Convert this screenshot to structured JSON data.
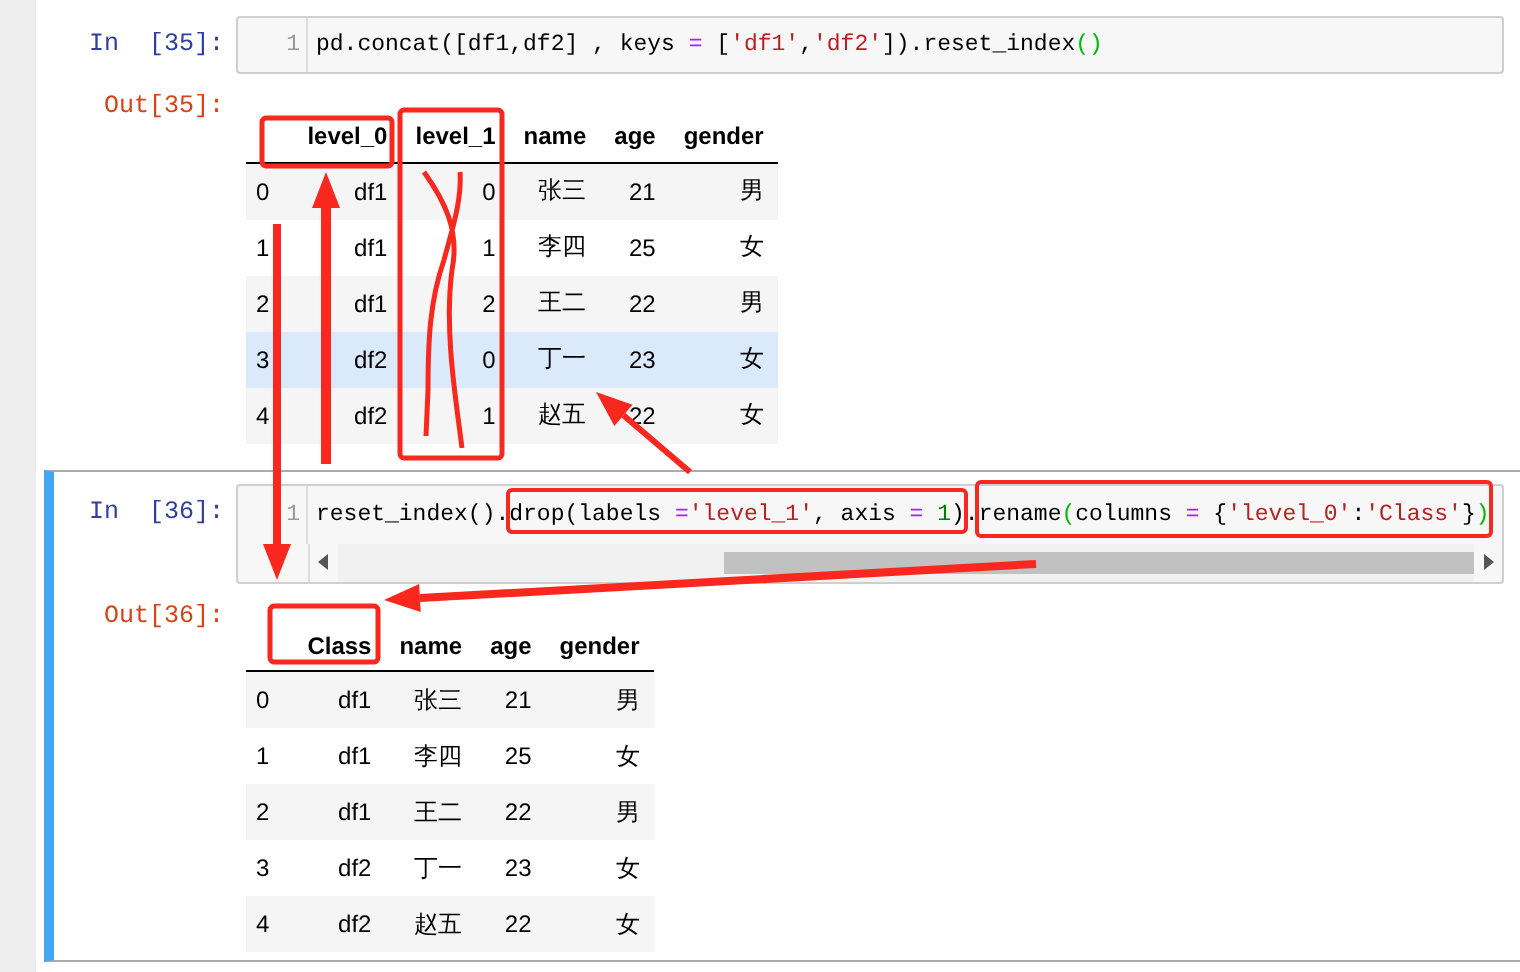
{
  "cells": [
    {
      "prompt_in": "In  [35]:",
      "selected": false,
      "h_scrollbar": false,
      "line_number": "1",
      "code": [
        {
          "text": "pd.concat([df1,df2] , keys ",
          "kind": "plain"
        },
        {
          "text": "=",
          "kind": "op"
        },
        {
          "text": " [",
          "kind": "plain"
        },
        {
          "text": "'df1'",
          "kind": "string"
        },
        {
          "text": ",",
          "kind": "plain"
        },
        {
          "text": "'df2'",
          "kind": "string"
        },
        {
          "text": "]).reset_index",
          "kind": "plain"
        },
        {
          "text": "()",
          "kind": "paren"
        }
      ],
      "prompt_out": "Out[35]:",
      "table": {
        "columns": [
          "level_0",
          "level_1",
          "name",
          "age",
          "gender"
        ],
        "rows": [
          {
            "index": "0",
            "cells": [
              "df1",
              "0",
              "张三",
              "21",
              "男"
            ],
            "hovered": false
          },
          {
            "index": "1",
            "cells": [
              "df1",
              "1",
              "李四",
              "25",
              "女"
            ],
            "hovered": false
          },
          {
            "index": "2",
            "cells": [
              "df1",
              "2",
              "王二",
              "22",
              "男"
            ],
            "hovered": false
          },
          {
            "index": "3",
            "cells": [
              "df2",
              "0",
              "丁一",
              "23",
              "女"
            ],
            "hovered": true
          },
          {
            "index": "4",
            "cells": [
              "df2",
              "1",
              "赵五",
              "22",
              "女"
            ],
            "hovered": false
          }
        ]
      }
    },
    {
      "prompt_in": "In  [36]:",
      "selected": true,
      "h_scrollbar": true,
      "line_number": "1",
      "code": [
        {
          "text": "reset_index().",
          "kind": "plain"
        },
        {
          "text": "drop(labels ",
          "kind": "plain"
        },
        {
          "text": "=",
          "kind": "op"
        },
        {
          "text": "'level_1'",
          "kind": "string"
        },
        {
          "text": ", axis ",
          "kind": "plain"
        },
        {
          "text": "=",
          "kind": "op"
        },
        {
          "text": " 1",
          "kind": "number"
        },
        {
          "text": ")",
          "kind": "plain"
        },
        {
          "text": ".",
          "kind": "plain"
        },
        {
          "text": "rename",
          "kind": "plain"
        },
        {
          "text": "(",
          "kind": "paren"
        },
        {
          "text": "columns ",
          "kind": "plain"
        },
        {
          "text": "=",
          "kind": "op"
        },
        {
          "text": " {",
          "kind": "plain"
        },
        {
          "text": "'level_0'",
          "kind": "string"
        },
        {
          "text": ":",
          "kind": "plain"
        },
        {
          "text": "'Class'",
          "kind": "string"
        },
        {
          "text": "}",
          "kind": "plain"
        },
        {
          "text": ")",
          "kind": "paren"
        }
      ],
      "prompt_out": "Out[36]:",
      "table": {
        "columns": [
          "Class",
          "name",
          "age",
          "gender"
        ],
        "rows": [
          {
            "index": "0",
            "cells": [
              "df1",
              "张三",
              "21",
              "男"
            ],
            "hovered": false
          },
          {
            "index": "1",
            "cells": [
              "df1",
              "李四",
              "25",
              "女"
            ],
            "hovered": false
          },
          {
            "index": "2",
            "cells": [
              "df1",
              "王二",
              "22",
              "男"
            ],
            "hovered": false
          },
          {
            "index": "3",
            "cells": [
              "df2",
              "丁一",
              "23",
              "女"
            ],
            "hovered": false
          },
          {
            "index": "4",
            "cells": [
              "df2",
              "赵五",
              "22",
              "女"
            ],
            "hovered": false
          }
        ]
      }
    }
  ]
}
